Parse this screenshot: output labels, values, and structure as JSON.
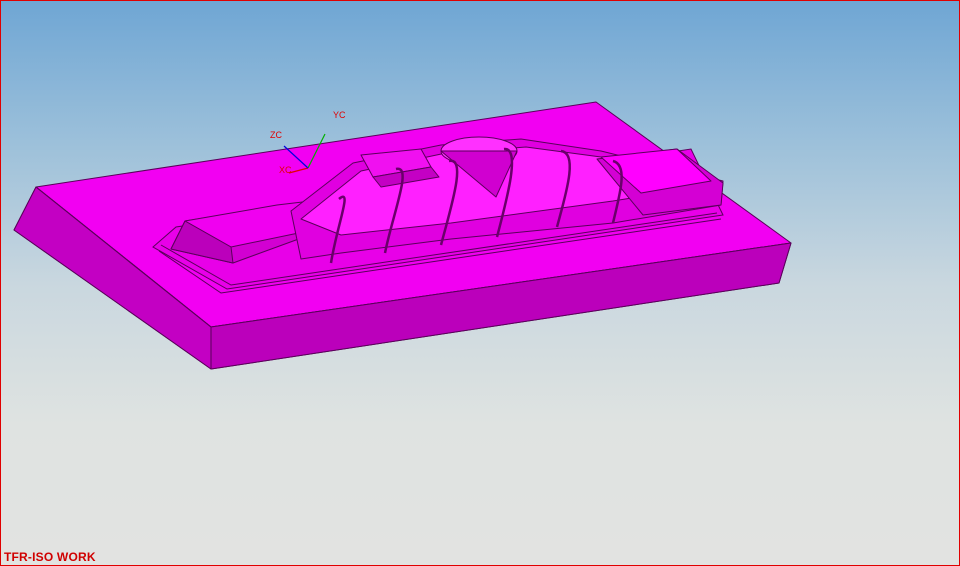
{
  "viewport": {
    "view_name": "TFR-ISO WORK",
    "view_name_color": "#d00000",
    "border_color": "#e00000",
    "background_top": "#6fa6d4",
    "background_bottom": "#e2e3e1"
  },
  "model": {
    "color": "#ff00ff",
    "shade_color": "#b000b0",
    "edge_color": "#5a005a"
  },
  "triad": {
    "xc_label": "XC",
    "yc_label": "YC",
    "zc_label": "ZC",
    "xc_color": "#e00000",
    "yc_color": "#00b000",
    "zc_color": "#0000e0"
  }
}
